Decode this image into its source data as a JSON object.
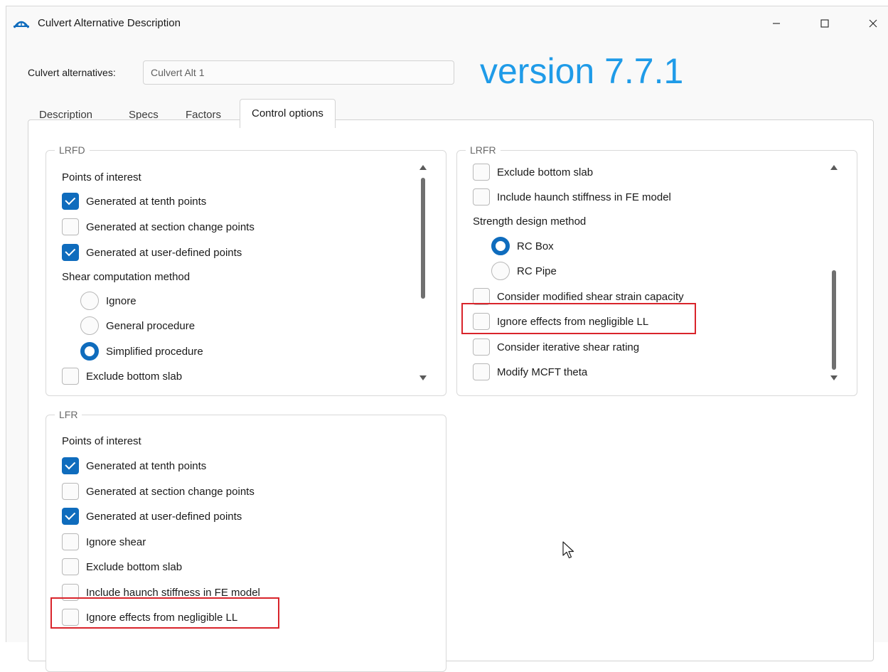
{
  "window": {
    "title": "Culvert Alternative Description",
    "version_label": "version 7.7.1"
  },
  "alternatives": {
    "label": "Culvert alternatives:",
    "value": "Culvert Alt 1"
  },
  "tabs": [
    {
      "label": "Description"
    },
    {
      "label": "Specs"
    },
    {
      "label": "Factors"
    },
    {
      "label": "Control options",
      "selected": true
    }
  ],
  "lrfd": {
    "title": "LRFD",
    "poi_heading": "Points of interest",
    "poi_items": [
      {
        "label": "Generated at tenth points",
        "checked": true
      },
      {
        "label": "Generated at section change points",
        "checked": false
      },
      {
        "label": "Generated at user-defined points",
        "checked": true
      }
    ],
    "shear_heading": "Shear computation method",
    "shear_options": [
      {
        "label": "Ignore",
        "selected": false
      },
      {
        "label": "General procedure",
        "selected": false
      },
      {
        "label": "Simplified procedure",
        "selected": true
      }
    ],
    "exclude_bottom_slab": {
      "label": "Exclude bottom slab",
      "checked": false
    }
  },
  "lrfr": {
    "title": "LRFR",
    "items_top": [
      {
        "label": "Exclude bottom slab",
        "checked": false
      },
      {
        "label": "Include haunch stiffness in FE model",
        "checked": false
      }
    ],
    "strength_heading": "Strength design method",
    "strength_options": [
      {
        "label": "RC Box",
        "selected": true
      },
      {
        "label": "RC Pipe",
        "selected": false
      }
    ],
    "items_bottom": [
      {
        "label": "Consider modified shear strain capacity",
        "checked": false
      },
      {
        "label": "Ignore effects from negligible LL",
        "checked": false
      },
      {
        "label": "Consider iterative shear rating",
        "checked": false
      },
      {
        "label": "Modify MCFT theta",
        "checked": false
      }
    ]
  },
  "lfr": {
    "title": "LFR",
    "poi_heading": "Points of interest",
    "items": [
      {
        "label": "Generated at tenth points",
        "checked": true
      },
      {
        "label": "Generated at section change points",
        "checked": false
      },
      {
        "label": "Generated at user-defined points",
        "checked": true
      },
      {
        "label": "Ignore shear",
        "checked": false
      },
      {
        "label": "Exclude bottom slab",
        "checked": false
      },
      {
        "label": "Include haunch stiffness in FE model",
        "checked": false
      },
      {
        "label": "Ignore effects from negligible LL",
        "checked": false
      }
    ]
  },
  "colors": {
    "accent": "#0f6cbd",
    "version_text": "#1f9be8",
    "highlight": "#d9242b"
  },
  "icons": {
    "app": "bridge-icon",
    "minimize": "minimize-icon",
    "maximize": "maximize-icon",
    "close": "close-icon",
    "cursor": "mouse-pointer-icon"
  }
}
